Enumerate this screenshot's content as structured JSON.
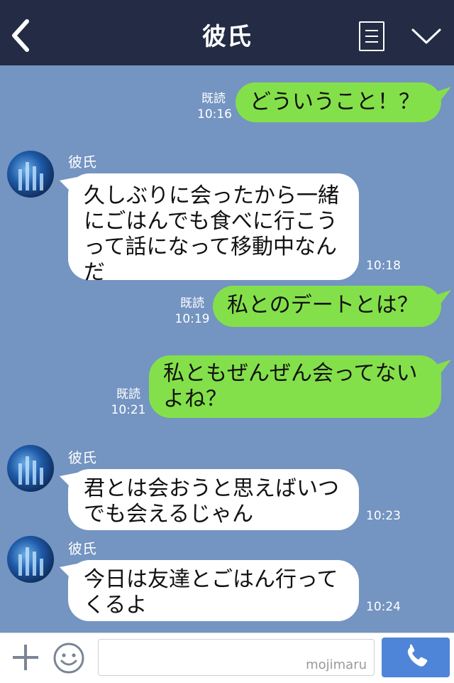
{
  "header": {
    "title": "彼氏"
  },
  "messages": [
    {
      "read": "既読",
      "time": "10:16",
      "text": "どういうこと！？"
    },
    {
      "sender": "彼氏",
      "time": "10:18",
      "lines": [
        "久しぶりに会ったから一緒",
        "にごはんでも食べに行こう",
        "って話になって移動中なん",
        "だ"
      ]
    },
    {
      "read": "既読",
      "time": "10:19",
      "text": "私とのデートとは？"
    },
    {
      "read": "既読",
      "time": "10:21",
      "lines": [
        "私ともぜんぜん会ってない",
        "よね？"
      ]
    },
    {
      "sender": "彼氏",
      "time": "10:23",
      "lines": [
        "君とは会おうと思えばいつ",
        "でも会えるじゃん"
      ]
    },
    {
      "sender": "彼氏",
      "time": "10:24",
      "lines": [
        "今日は友達とごはん行って",
        "くるよ"
      ]
    }
  ],
  "footer": {
    "watermark": "mojimaru"
  },
  "icons": {
    "back": "chevron-left-icon",
    "menu": "menu-icon",
    "collapse": "chevron-down-icon",
    "plus": "plus-icon",
    "emoji": "smiley-icon",
    "call": "phone-icon"
  },
  "colors": {
    "header": "#232c44",
    "chat_bg": "#7494c1",
    "outgoing": "#84e04a",
    "incoming": "#ffffff",
    "call_button": "#4f85d8"
  }
}
